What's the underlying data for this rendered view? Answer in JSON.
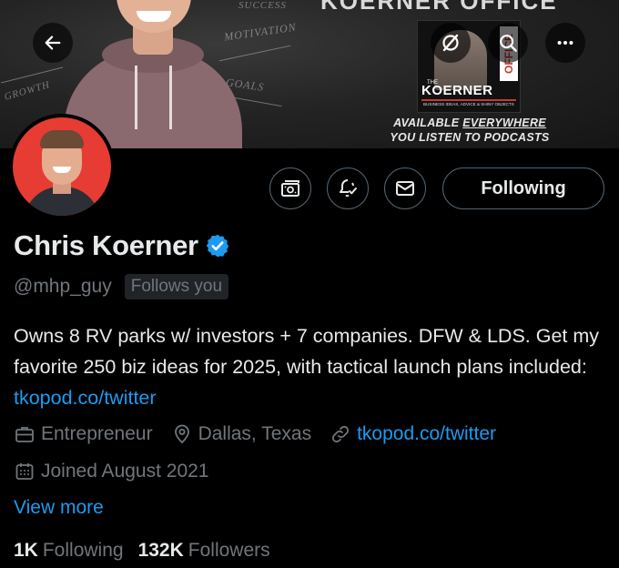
{
  "banner": {
    "chalk_words": [
      "MOTIVATION",
      "GOALS",
      "GROWTH",
      "SUCCESS"
    ],
    "podcast_the": "THE",
    "podcast_name": "KOERNER",
    "podcast_office": "OFFICE",
    "podcast_tagline": "BUSINESS IDEAS, ADVICE & SHINY OBJECTS",
    "available_line1_a": "AVAILABLE ",
    "available_line1_b": "EVERYWHERE",
    "available_line2": "YOU LISTEN TO PODCASTS"
  },
  "toolbar": {
    "back_icon": "arrow-left-icon",
    "grok_icon": "grok-icon",
    "search_icon": "search-icon",
    "more_icon": "more-icon"
  },
  "actions": {
    "subscribe_icon": "money-icon",
    "notify_icon": "bell-check-icon",
    "message_icon": "envelope-icon",
    "following_label": "Following"
  },
  "profile": {
    "name": "Chris Koerner",
    "handle": "@mhp_guy",
    "follows_you": "Follows you",
    "bio_text": "Owns 8 RV parks w/ investors + 7 companies. DFW & LDS. Get my favorite 250 biz ideas for 2025, with tactical launch plans included: ",
    "bio_link": "tkopod.co/twitter",
    "category": "Entrepreneur",
    "location": "Dallas, Texas",
    "website": "tkopod.co/twitter",
    "joined": "Joined August 2021",
    "view_more": "View more",
    "following_count": "1K",
    "following_label": "Following",
    "followers_count": "132K",
    "followers_label": "Followers"
  },
  "colors": {
    "accent": "#1d9bf0",
    "muted": "#71767b",
    "text": "#e7e9ea",
    "avatar_bg": "#e73c33"
  }
}
